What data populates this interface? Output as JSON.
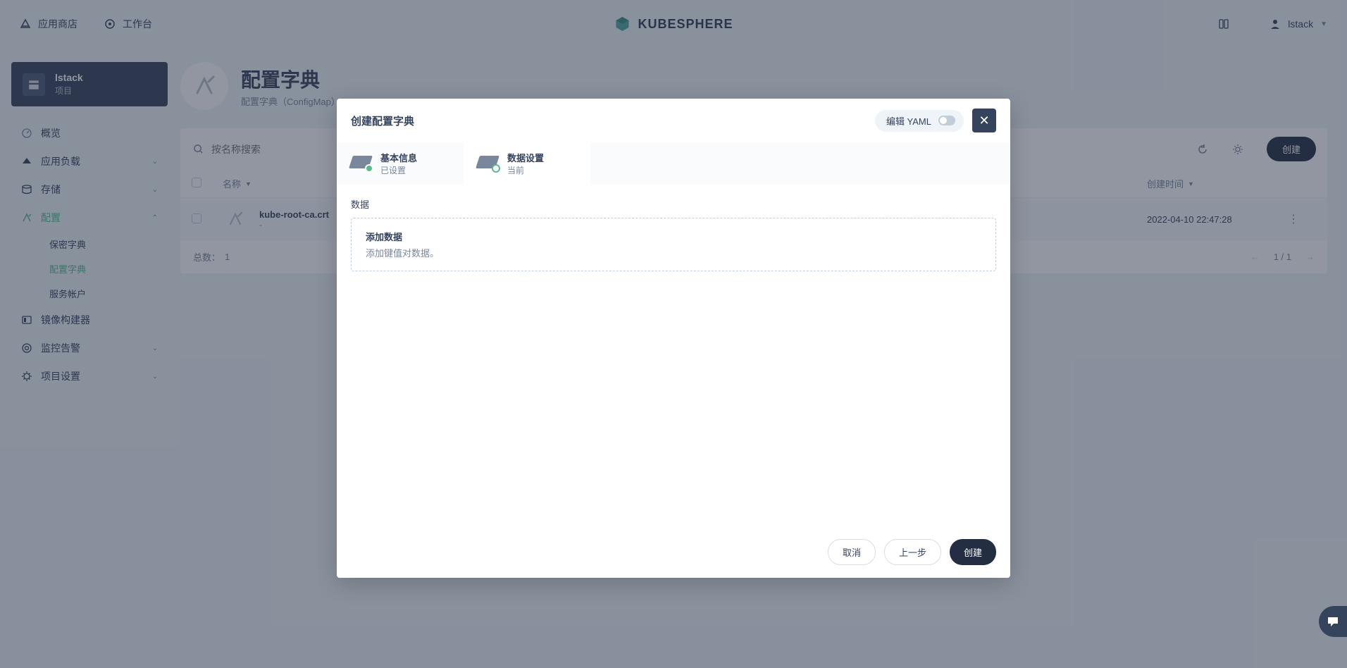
{
  "topbar": {
    "app_store": "应用商店",
    "workbench": "工作台",
    "brand": "KUBESPHERE",
    "user": "lstack"
  },
  "sidebar": {
    "project_name": "lstack",
    "project_label": "项目",
    "items": [
      {
        "label": "概览"
      },
      {
        "label": "应用负载"
      },
      {
        "label": "存储"
      },
      {
        "label": "配置"
      },
      {
        "label": "镜像构建器"
      },
      {
        "label": "监控告警"
      },
      {
        "label": "项目设置"
      }
    ],
    "config_sub": [
      {
        "label": "保密字典"
      },
      {
        "label": "配置字典"
      },
      {
        "label": "服务帐户"
      }
    ]
  },
  "page": {
    "title": "配置字典",
    "subtitle": "配置字典（ConfigMap）"
  },
  "table": {
    "search_placeholder": "按名称搜索",
    "create_label": "创建",
    "col_name": "名称",
    "col_created": "创建时间",
    "rows": [
      {
        "name": "kube-root-ca.crt",
        "sub": "-",
        "created": "2022-04-10 22:47:28"
      }
    ],
    "total_label": "总数：",
    "total_value": "1",
    "page_info": "1 / 1"
  },
  "modal": {
    "title": "创建配置字典",
    "edit_yaml": "编辑 YAML",
    "tabs": [
      {
        "title": "基本信息",
        "sub": "已设置"
      },
      {
        "title": "数据设置",
        "sub": "当前"
      }
    ],
    "section_label": "数据",
    "add_data_title": "添加数据",
    "add_data_desc": "添加键值对数据。",
    "cancel": "取消",
    "previous": "上一步",
    "create": "创建"
  }
}
